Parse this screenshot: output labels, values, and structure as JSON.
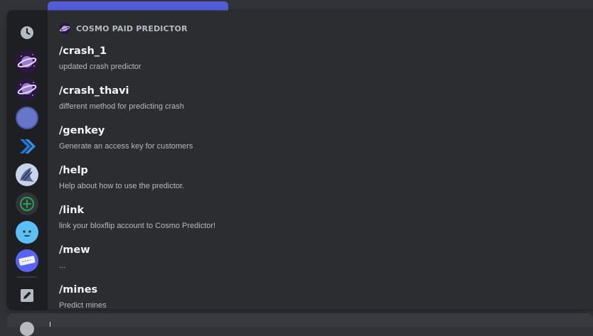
{
  "header": {
    "app_name": "COSMO PAID PREDICTOR",
    "icon": "planet-icon"
  },
  "rail": [
    {
      "name": "recent-clock",
      "icon": "clock-icon"
    },
    {
      "name": "cosmo-app-1",
      "icon": "planet-icon"
    },
    {
      "name": "cosmo-app-2",
      "icon": "planet-icon"
    },
    {
      "name": "blue-app",
      "icon": "blank-avatar-icon"
    },
    {
      "name": "arrow-app",
      "icon": "chevrons-icon"
    },
    {
      "name": "art-app",
      "icon": "painting-icon"
    },
    {
      "name": "add-app",
      "icon": "plus-circle-icon"
    },
    {
      "name": "face-app",
      "icon": "face-icon"
    },
    {
      "name": "tickets-app",
      "icon": "tickets-icon"
    },
    {
      "name": "edit-app",
      "icon": "pencil-icon"
    }
  ],
  "commands": [
    {
      "name": "/crash_1",
      "desc": "updated crash predictor"
    },
    {
      "name": "/crash_thavi",
      "desc": "different method for predicting crash"
    },
    {
      "name": "/genkey",
      "desc": "Generate an access key for customers"
    },
    {
      "name": "/help",
      "desc": "Help about how to use the predictor."
    },
    {
      "name": "/link",
      "desc": "link your bloxflip account to Cosmo Predictor!"
    },
    {
      "name": "/mew",
      "desc": "..."
    },
    {
      "name": "/mines",
      "desc": "Predict mines"
    }
  ],
  "colors": {
    "background": "#313338",
    "panel": "#2b2d31",
    "rail": "#1e1f22",
    "text_primary": "#f2f3f5",
    "text_secondary": "#b5bac1",
    "accent": "#5865f2"
  }
}
